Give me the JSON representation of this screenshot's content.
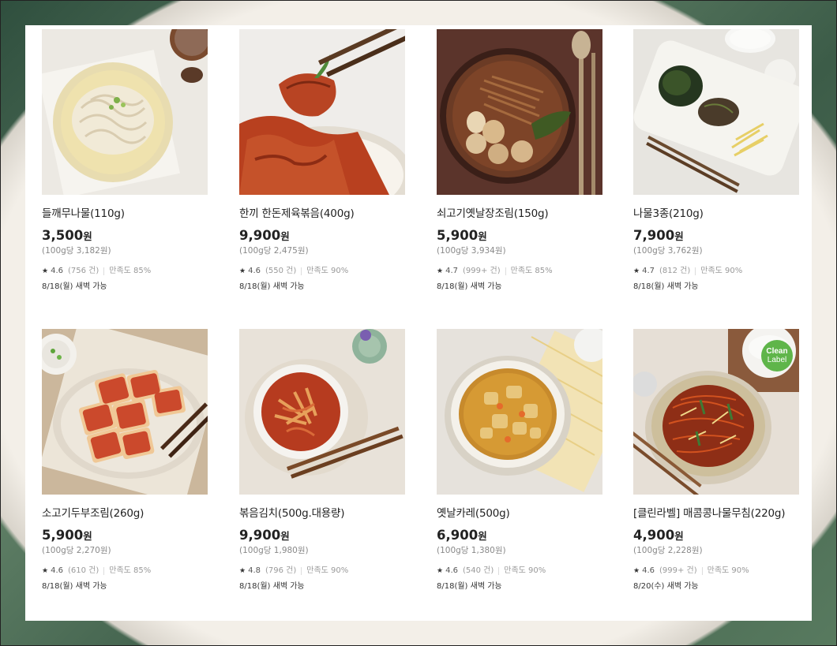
{
  "products": [
    {
      "name": "들깨무나물(110g)",
      "price": "3,500",
      "won": "원",
      "unit_price": "(100g당 3,182원)",
      "rating": "4.6",
      "reviews": "(756 건)",
      "satisfaction": "만족도 85%",
      "delivery": "8/18(월) 새벽 가능",
      "image": "perilla-radish-namul"
    },
    {
      "name": "한끼 한돈제육볶음(400g)",
      "price": "9,900",
      "won": "원",
      "unit_price": "(100g당 2,475원)",
      "rating": "4.6",
      "reviews": "(550 건)",
      "satisfaction": "만족도 90%",
      "delivery": "8/18(월) 새벽 가능",
      "image": "spicy-pork-stirfry"
    },
    {
      "name": "쇠고기옛날장조림(150g)",
      "price": "5,900",
      "won": "원",
      "unit_price": "(100g당 3,934원)",
      "rating": "4.7",
      "reviews": "(999+ 건)",
      "satisfaction": "만족도 85%",
      "delivery": "8/18(월) 새벽 가능",
      "image": "beef-jangjorim"
    },
    {
      "name": "나물3종(210g)",
      "price": "7,900",
      "won": "원",
      "unit_price": "(100g당 3,762원)",
      "rating": "4.7",
      "reviews": "(812 건)",
      "satisfaction": "만족도 90%",
      "delivery": "8/18(월) 새벽 가능",
      "image": "three-namul"
    },
    {
      "name": "소고기두부조림(260g)",
      "price": "5,900",
      "won": "원",
      "unit_price": "(100g당 2,270원)",
      "rating": "4.6",
      "reviews": "(610 건)",
      "satisfaction": "만족도 85%",
      "delivery": "8/18(월) 새벽 가능",
      "image": "braised-tofu"
    },
    {
      "name": "볶음김치(500g.대용량)",
      "price": "9,900",
      "won": "원",
      "unit_price": "(100g당 1,980원)",
      "rating": "4.8",
      "reviews": "(796 건)",
      "satisfaction": "만족도 90%",
      "delivery": "8/18(월) 새벽 가능",
      "image": "stirfried-kimchi"
    },
    {
      "name": "옛날카레(500g)",
      "price": "6,900",
      "won": "원",
      "unit_price": "(100g당 1,380원)",
      "rating": "4.6",
      "reviews": "(540 건)",
      "satisfaction": "만족도 90%",
      "delivery": "8/18(월) 새벽 가능",
      "image": "curry"
    },
    {
      "name": "[클린라벨] 매콤콩나물무침(220g)",
      "price": "4,900",
      "won": "원",
      "unit_price": "(100g당 2,228원)",
      "rating": "4.6",
      "reviews": "(999+ 건)",
      "satisfaction": "만족도 90%",
      "delivery": "8/20(수) 새벽 가능",
      "image": "spicy-bean-sprouts",
      "badge": [
        "Clean",
        "Label"
      ]
    }
  ],
  "star_icon": "★"
}
